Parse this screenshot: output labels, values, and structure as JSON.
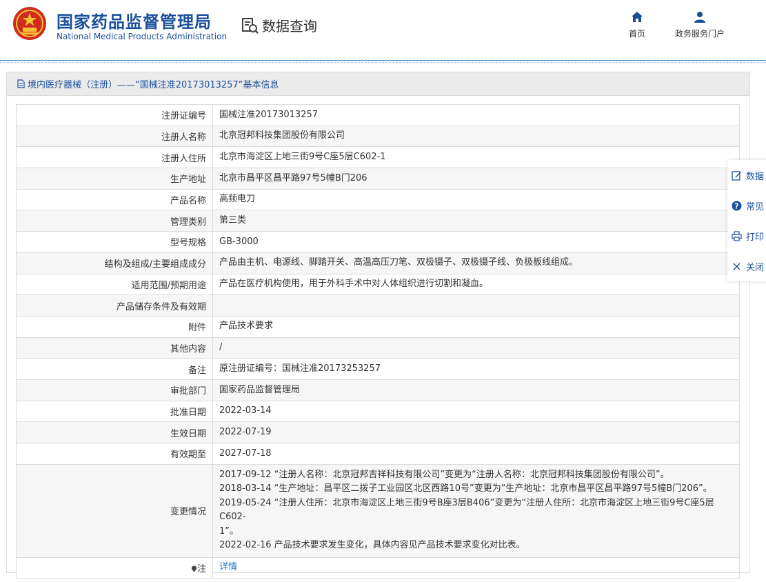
{
  "header": {
    "org_cn": "国家药品监督管理局",
    "org_en": "National Medical Products Administration",
    "query_title": "数据查询",
    "nav": [
      {
        "label": "首页",
        "icon": "home-icon"
      },
      {
        "label": "政务服务门户",
        "icon": "user-icon"
      }
    ]
  },
  "panel": {
    "title": "境内医疗器械（注册）——“国械注准20173013257”基本信息"
  },
  "rows": [
    {
      "key": "注册证编号",
      "value": "国械注准20173013257"
    },
    {
      "key": "注册人名称",
      "value": "北京冠邦科技集团股份有限公司"
    },
    {
      "key": "注册人住所",
      "value": "北京市海淀区上地三街9号C座5层C602-1"
    },
    {
      "key": "生产地址",
      "value": "北京市昌平区昌平路97号5幢B门206"
    },
    {
      "key": "产品名称",
      "value": "高频电刀"
    },
    {
      "key": "管理类别",
      "value": "第三类"
    },
    {
      "key": "型号规格",
      "value": "GB-3000"
    },
    {
      "key": "结构及组成/主要组成成分",
      "value": "产品由主机、电源线、脚踏开关、高温高压刀笔、双极镊子、双极镊子线、负极板线组成。"
    },
    {
      "key": "适用范围/预期用途",
      "value": "产品在医疗机构使用，用于外科手术中对人体组织进行切割和凝血。"
    },
    {
      "key": "产品储存条件及有效期",
      "value": ""
    },
    {
      "key": "附件",
      "value": "产品技术要求"
    },
    {
      "key": "其他内容",
      "value": "/"
    },
    {
      "key": "备注",
      "value": "原注册证编号：国械注准20173253257"
    },
    {
      "key": "审批部门",
      "value": "国家药品监督管理局"
    },
    {
      "key": "批准日期",
      "value": "2022-03-14"
    },
    {
      "key": "生效日期",
      "value": "2022-07-19"
    },
    {
      "key": "有效期至",
      "value": "2027-07-18"
    }
  ],
  "changes": {
    "key": "变更情况",
    "lines": [
      "2017-09-12 “注册人名称：北京冠邦吉祥科技有限公司”变更为“注册人名称：北京冠邦科技集团股份有限公司”。",
      "2018-03-14 “生产地址：昌平区二拨子工业园区北区西路10号”变更为“生产地址：北京市昌平区昌平路97号5幢B门206”。",
      "2019-05-24 “注册人住所：北京市海淀区上地三街9号B座3层B406”变更为“注册人住所：北京市海淀区上地三街9号C座5层C602-",
      "1”。",
      "2022-02-16 产品技术要求发生变化，具体内容见产品技术要求变化对比表。"
    ]
  },
  "note": {
    "key": "注",
    "link": "详情"
  },
  "float_bar": [
    {
      "label": "数据",
      "icon": "edit-icon"
    },
    {
      "label": "常见",
      "icon": "help-icon"
    },
    {
      "label": "打印",
      "icon": "print-icon"
    },
    {
      "label": "关闭",
      "icon": "close-icon"
    }
  ]
}
